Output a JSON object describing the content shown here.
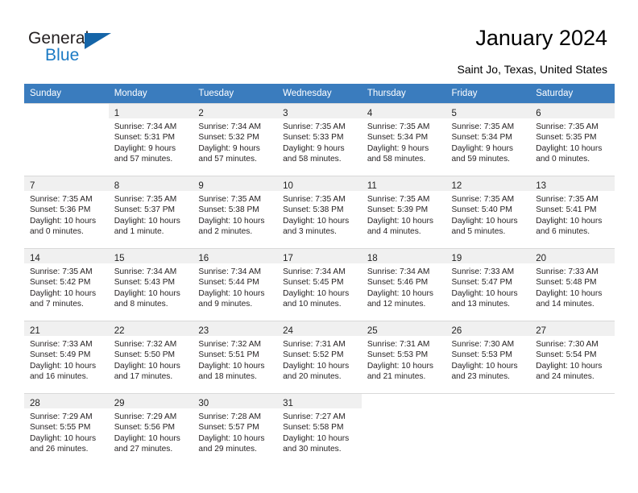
{
  "brand": {
    "name_part1": "General",
    "name_part2": "Blue",
    "accent_color": "#1b7ac4",
    "triangle_color": "#1565a8"
  },
  "header": {
    "title": "January 2024",
    "location": "Saint Jo, Texas, United States"
  },
  "calendar": {
    "header_bg": "#3a7cbe",
    "weekdays": [
      "Sunday",
      "Monday",
      "Tuesday",
      "Wednesday",
      "Thursday",
      "Friday",
      "Saturday"
    ],
    "weeks": [
      [
        {
          "day": "",
          "sunrise": "",
          "sunset": "",
          "daylight": ""
        },
        {
          "day": "1",
          "sunrise": "Sunrise: 7:34 AM",
          "sunset": "Sunset: 5:31 PM",
          "daylight": "Daylight: 9 hours and 57 minutes."
        },
        {
          "day": "2",
          "sunrise": "Sunrise: 7:34 AM",
          "sunset": "Sunset: 5:32 PM",
          "daylight": "Daylight: 9 hours and 57 minutes."
        },
        {
          "day": "3",
          "sunrise": "Sunrise: 7:35 AM",
          "sunset": "Sunset: 5:33 PM",
          "daylight": "Daylight: 9 hours and 58 minutes."
        },
        {
          "day": "4",
          "sunrise": "Sunrise: 7:35 AM",
          "sunset": "Sunset: 5:34 PM",
          "daylight": "Daylight: 9 hours and 58 minutes."
        },
        {
          "day": "5",
          "sunrise": "Sunrise: 7:35 AM",
          "sunset": "Sunset: 5:34 PM",
          "daylight": "Daylight: 9 hours and 59 minutes."
        },
        {
          "day": "6",
          "sunrise": "Sunrise: 7:35 AM",
          "sunset": "Sunset: 5:35 PM",
          "daylight": "Daylight: 10 hours and 0 minutes."
        }
      ],
      [
        {
          "day": "7",
          "sunrise": "Sunrise: 7:35 AM",
          "sunset": "Sunset: 5:36 PM",
          "daylight": "Daylight: 10 hours and 0 minutes."
        },
        {
          "day": "8",
          "sunrise": "Sunrise: 7:35 AM",
          "sunset": "Sunset: 5:37 PM",
          "daylight": "Daylight: 10 hours and 1 minute."
        },
        {
          "day": "9",
          "sunrise": "Sunrise: 7:35 AM",
          "sunset": "Sunset: 5:38 PM",
          "daylight": "Daylight: 10 hours and 2 minutes."
        },
        {
          "day": "10",
          "sunrise": "Sunrise: 7:35 AM",
          "sunset": "Sunset: 5:38 PM",
          "daylight": "Daylight: 10 hours and 3 minutes."
        },
        {
          "day": "11",
          "sunrise": "Sunrise: 7:35 AM",
          "sunset": "Sunset: 5:39 PM",
          "daylight": "Daylight: 10 hours and 4 minutes."
        },
        {
          "day": "12",
          "sunrise": "Sunrise: 7:35 AM",
          "sunset": "Sunset: 5:40 PM",
          "daylight": "Daylight: 10 hours and 5 minutes."
        },
        {
          "day": "13",
          "sunrise": "Sunrise: 7:35 AM",
          "sunset": "Sunset: 5:41 PM",
          "daylight": "Daylight: 10 hours and 6 minutes."
        }
      ],
      [
        {
          "day": "14",
          "sunrise": "Sunrise: 7:35 AM",
          "sunset": "Sunset: 5:42 PM",
          "daylight": "Daylight: 10 hours and 7 minutes."
        },
        {
          "day": "15",
          "sunrise": "Sunrise: 7:34 AM",
          "sunset": "Sunset: 5:43 PM",
          "daylight": "Daylight: 10 hours and 8 minutes."
        },
        {
          "day": "16",
          "sunrise": "Sunrise: 7:34 AM",
          "sunset": "Sunset: 5:44 PM",
          "daylight": "Daylight: 10 hours and 9 minutes."
        },
        {
          "day": "17",
          "sunrise": "Sunrise: 7:34 AM",
          "sunset": "Sunset: 5:45 PM",
          "daylight": "Daylight: 10 hours and 10 minutes."
        },
        {
          "day": "18",
          "sunrise": "Sunrise: 7:34 AM",
          "sunset": "Sunset: 5:46 PM",
          "daylight": "Daylight: 10 hours and 12 minutes."
        },
        {
          "day": "19",
          "sunrise": "Sunrise: 7:33 AM",
          "sunset": "Sunset: 5:47 PM",
          "daylight": "Daylight: 10 hours and 13 minutes."
        },
        {
          "day": "20",
          "sunrise": "Sunrise: 7:33 AM",
          "sunset": "Sunset: 5:48 PM",
          "daylight": "Daylight: 10 hours and 14 minutes."
        }
      ],
      [
        {
          "day": "21",
          "sunrise": "Sunrise: 7:33 AM",
          "sunset": "Sunset: 5:49 PM",
          "daylight": "Daylight: 10 hours and 16 minutes."
        },
        {
          "day": "22",
          "sunrise": "Sunrise: 7:32 AM",
          "sunset": "Sunset: 5:50 PM",
          "daylight": "Daylight: 10 hours and 17 minutes."
        },
        {
          "day": "23",
          "sunrise": "Sunrise: 7:32 AM",
          "sunset": "Sunset: 5:51 PM",
          "daylight": "Daylight: 10 hours and 18 minutes."
        },
        {
          "day": "24",
          "sunrise": "Sunrise: 7:31 AM",
          "sunset": "Sunset: 5:52 PM",
          "daylight": "Daylight: 10 hours and 20 minutes."
        },
        {
          "day": "25",
          "sunrise": "Sunrise: 7:31 AM",
          "sunset": "Sunset: 5:53 PM",
          "daylight": "Daylight: 10 hours and 21 minutes."
        },
        {
          "day": "26",
          "sunrise": "Sunrise: 7:30 AM",
          "sunset": "Sunset: 5:53 PM",
          "daylight": "Daylight: 10 hours and 23 minutes."
        },
        {
          "day": "27",
          "sunrise": "Sunrise: 7:30 AM",
          "sunset": "Sunset: 5:54 PM",
          "daylight": "Daylight: 10 hours and 24 minutes."
        }
      ],
      [
        {
          "day": "28",
          "sunrise": "Sunrise: 7:29 AM",
          "sunset": "Sunset: 5:55 PM",
          "daylight": "Daylight: 10 hours and 26 minutes."
        },
        {
          "day": "29",
          "sunrise": "Sunrise: 7:29 AM",
          "sunset": "Sunset: 5:56 PM",
          "daylight": "Daylight: 10 hours and 27 minutes."
        },
        {
          "day": "30",
          "sunrise": "Sunrise: 7:28 AM",
          "sunset": "Sunset: 5:57 PM",
          "daylight": "Daylight: 10 hours and 29 minutes."
        },
        {
          "day": "31",
          "sunrise": "Sunrise: 7:27 AM",
          "sunset": "Sunset: 5:58 PM",
          "daylight": "Daylight: 10 hours and 30 minutes."
        },
        {
          "day": "",
          "sunrise": "",
          "sunset": "",
          "daylight": ""
        },
        {
          "day": "",
          "sunrise": "",
          "sunset": "",
          "daylight": ""
        },
        {
          "day": "",
          "sunrise": "",
          "sunset": "",
          "daylight": ""
        }
      ]
    ]
  }
}
